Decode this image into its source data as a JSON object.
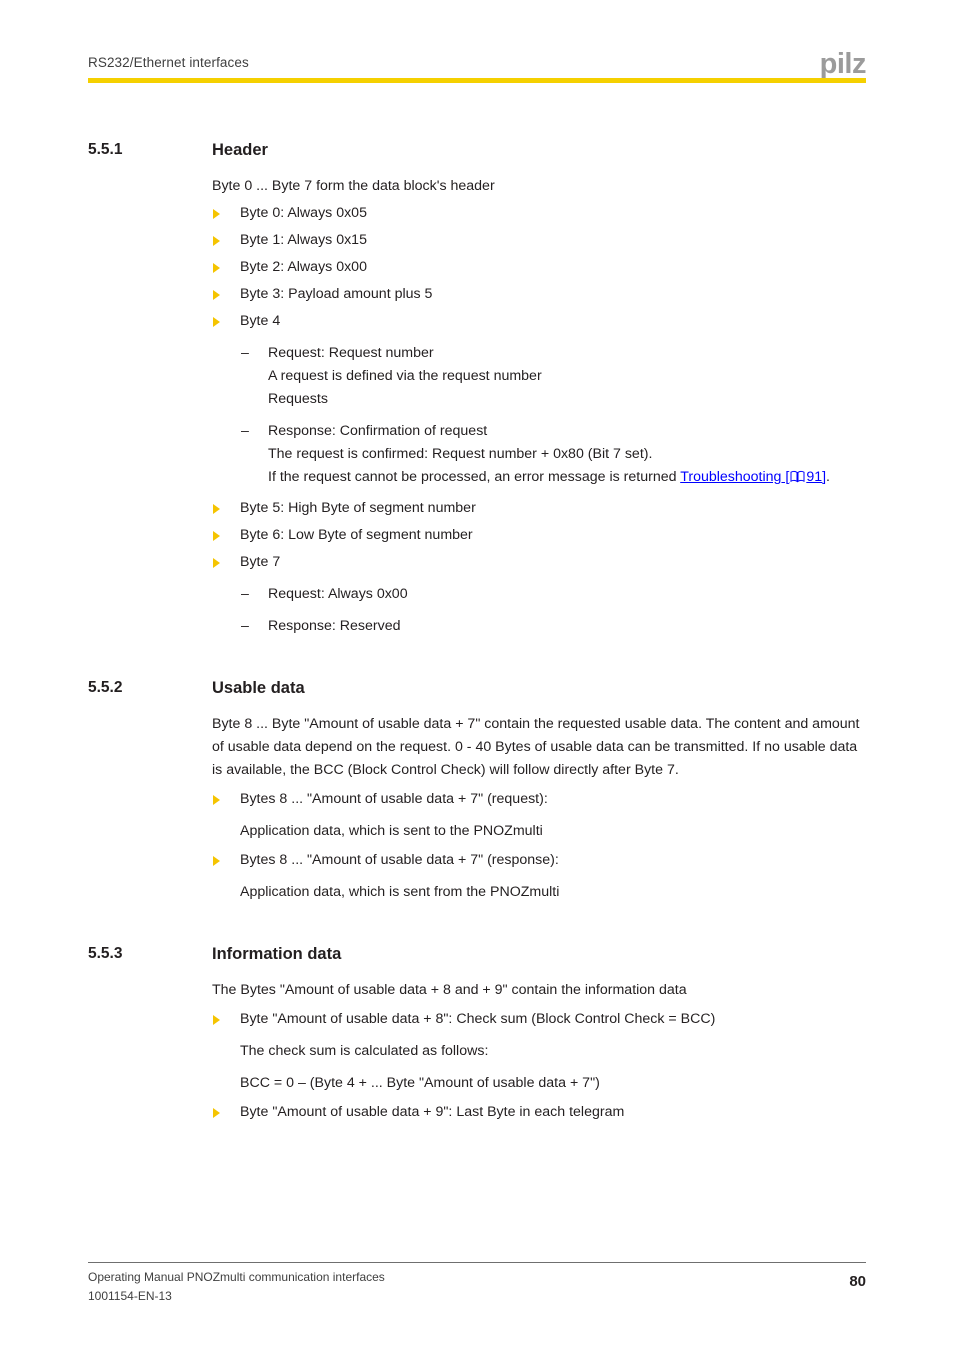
{
  "header": {
    "title": "RS232/Ethernet interfaces",
    "logo": "pilz",
    "rule_color": "#f5d000"
  },
  "colors": {
    "bullet": "#f5c400",
    "link": "#0000ff",
    "text": "#231f20",
    "brand_gray": "#9b9b9b"
  },
  "sections": [
    {
      "number": "5.5.1",
      "title": "Header",
      "intro": "Byte 0 ... Byte 7 form the data block's header",
      "items": [
        {
          "text": "Byte 0: Always 0x05"
        },
        {
          "text": "Byte 1: Always 0x15"
        },
        {
          "text": "Byte 2: Always 0x00"
        },
        {
          "text": "Byte 3: Payload amount plus 5"
        },
        {
          "text": "Byte 4",
          "sub": [
            {
              "lines": [
                "Request: Request number",
                "A request is defined via the request number",
                "Requests"
              ]
            },
            {
              "lines": [
                "Response: Confirmation of request",
                "The request is confirmed: Request number + 0x80 (Bit 7 set)."
              ],
              "link_line": {
                "prefix": "If the request cannot be processed, an error message is returned ",
                "link_text": "Troubleshooting",
                "bracket_open": " [",
                "icon": "book-icon",
                "page_ref": "91",
                "bracket_close": "]",
                "suffix": "."
              }
            }
          ]
        },
        {
          "text": "Byte 5: High Byte of segment number"
        },
        {
          "text": "Byte 6: Low Byte of segment number"
        },
        {
          "text": "Byte 7",
          "sub": [
            {
              "lines": [
                "Request: Always 0x00"
              ]
            },
            {
              "lines": [
                "Response: Reserved"
              ]
            }
          ]
        }
      ]
    },
    {
      "number": "5.5.2",
      "title": "Usable data",
      "intro": "Byte 8 ... Byte \"Amount of usable data + 7\" contain the requested usable data. The content and amount of usable data depend on the request. 0 - 40 Bytes of usable data can be transmitted. If no usable data is available, the BCC (Block Control Check) will follow directly after Byte 7.",
      "items": [
        {
          "text": "Bytes 8 ... \"Amount of usable data + 7\" (request):",
          "note": "Application data, which is sent to the PNOZmulti"
        },
        {
          "text": "Bytes 8 ... \"Amount of usable data + 7\" (response):",
          "note": "Application data, which is sent from the PNOZmulti"
        }
      ]
    },
    {
      "number": "5.5.3",
      "title": "Information data",
      "intro": "The Bytes \"Amount of usable data + 8 and + 9\" contain the information data",
      "items": [
        {
          "text": "Byte \"Amount of usable data + 8\": Check sum (Block Control Check = BCC)",
          "note": "The check sum is calculated as follows:",
          "note2": "BCC = 0 – (Byte 4 + ... Byte \"Amount of usable data + 7\")"
        },
        {
          "text": "Byte \"Amount of usable data + 9\": Last Byte in each telegram"
        }
      ]
    }
  ],
  "footer": {
    "line1": "Operating Manual PNOZmulti communication interfaces",
    "line2": "1001154-EN-13",
    "page_number": "80"
  }
}
